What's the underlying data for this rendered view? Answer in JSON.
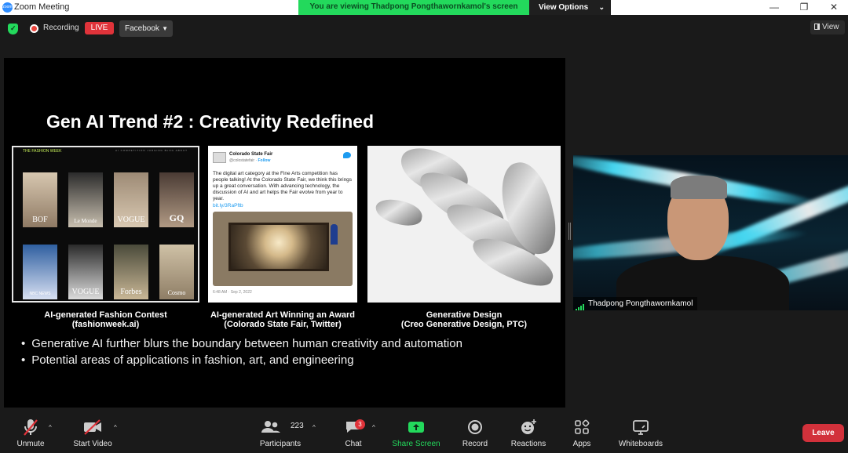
{
  "window": {
    "title": "Zoom Meeting",
    "logo_text": "zoom",
    "minimize": "—",
    "restore": "❐",
    "close": "✕"
  },
  "viewing_bar": {
    "text": "You are viewing Thadpong Pongthawornkamol's screen",
    "options_label": "View Options",
    "options_caret": "⌄"
  },
  "top_controls": {
    "recording_label": "Recording",
    "live_label": "LIVE",
    "stream_target": "Facebook",
    "stream_caret": "▼",
    "view_label": "View"
  },
  "slide": {
    "title": "Gen AI Trend #2 : Creativity Redefined",
    "fashion": {
      "logo": "THE FASHION WEEK",
      "nav": "AI COMPETITION   JUDGING   BLOG   ABOUT",
      "brands": [
        "BOF",
        "Le Monde",
        "VOGUE",
        "GQ",
        "NBC NEWS",
        "VOGUE",
        "Forbes",
        "Cosmo"
      ]
    },
    "tweet": {
      "account": "Colorado State Fair",
      "handle": "@colostatefair",
      "follow": "Follow",
      "body": "The digital art category at the Fine Arts competition has people talking! At the Colorado State Fair, we think this brings up a great conversation. With advancing technology, the discussion of AI and art helps the Fair evolve from year to year.",
      "link": "bit.ly/3RaPftb",
      "time": "6:48 AM · Sep 2, 2022"
    },
    "captions": [
      {
        "line1": "AI-generated Fashion Contest",
        "line2": "(fashionweek.ai)"
      },
      {
        "line1": "AI-generated Art Winning an Award",
        "line2": "(Colorado State Fair, Twitter)"
      },
      {
        "line1": "Generative Design",
        "line2": "(Creo Generative Design, PTC)"
      }
    ],
    "bullets": [
      "Generative AI further blurs the boundary between human creativity and automation",
      "Potential areas of applications in fashion, art, and engineering"
    ]
  },
  "participant": {
    "name": "Thadpong Pongthawornkamol"
  },
  "toolbar": {
    "unmute": "Unmute",
    "start_video": "Start Video",
    "participants": "Participants",
    "participant_count": "223",
    "chat": "Chat",
    "chat_badge": "3",
    "share_screen": "Share Screen",
    "record": "Record",
    "reactions": "Reactions",
    "apps": "Apps",
    "whiteboards": "Whiteboards",
    "leave": "Leave",
    "caret": "^"
  },
  "colors": {
    "zoom_blue": "#2d8cff",
    "share_green": "#23d95c",
    "leave_red": "#d2313b",
    "live_red": "#e0333a"
  }
}
